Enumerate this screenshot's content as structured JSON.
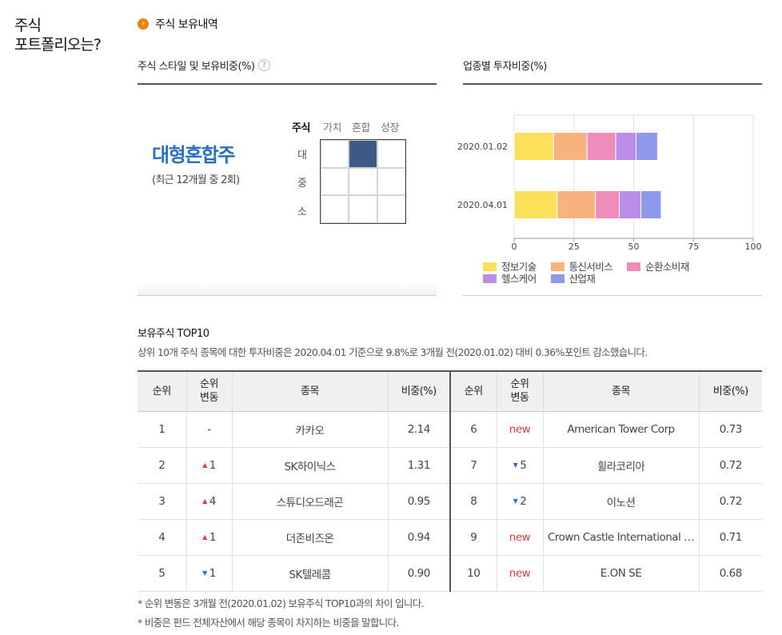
{
  "left_title": [
    "주식",
    "포트폴리오는?"
  ],
  "section_title": "주식 보유내역",
  "style_panel": {
    "title": "주식 스타일 및 보유비중(%)",
    "style_name": "대형혼합주",
    "style_note": "(최근 12개월 중 2회)",
    "col_header": "주식",
    "cols": [
      "가치",
      "혼합",
      "성장"
    ],
    "rows": [
      "대",
      "중",
      "소"
    ],
    "selected": {
      "row": 0,
      "col": 1
    }
  },
  "sector_panel": {
    "title": "업종별 투자비중(%)"
  },
  "chart_data": {
    "type": "bar",
    "orientation": "horizontal",
    "stacked": true,
    "categories": [
      "2020.01.02",
      "2020.04.01"
    ],
    "series": [
      {
        "name": "정보기술",
        "color": "#fde05a",
        "values": [
          16.5,
          18.0
        ]
      },
      {
        "name": "통신서비스",
        "color": "#f7b27d",
        "values": [
          14.0,
          16.0
        ]
      },
      {
        "name": "순환소비재",
        "color": "#ee8cbc",
        "values": [
          12.0,
          10.0
        ]
      },
      {
        "name": "헬스케어",
        "color": "#bb8ce8",
        "values": [
          8.5,
          9.0
        ]
      },
      {
        "name": "산업재",
        "color": "#8e99ec",
        "values": [
          9.0,
          8.5
        ]
      }
    ],
    "xlim": [
      0,
      100
    ],
    "xticks": [
      0,
      25,
      50,
      75,
      100
    ],
    "grid": true,
    "legend": "bottom"
  },
  "top10": {
    "title": "보유주식 TOP10",
    "description": "상위 10개 주식 종목에 대한 투자비중은 2020.04.01 기준으로 9.8%로 3개월 전(2020.01.02) 대비 0.36%포인트 감소했습니다.",
    "headers": {
      "rank": "순위",
      "change_l1": "순위",
      "change_l2": "변동",
      "name": "종목",
      "weight": "비중(%)"
    },
    "rows": [
      {
        "rank": "1",
        "dir": "none",
        "change": "-",
        "name": "카카오",
        "weight": "2.14"
      },
      {
        "rank": "2",
        "dir": "up",
        "change": "1",
        "name": "SK하이닉스",
        "weight": "1.31"
      },
      {
        "rank": "3",
        "dir": "up",
        "change": "4",
        "name": "스튜디오드래곤",
        "weight": "0.95"
      },
      {
        "rank": "4",
        "dir": "up",
        "change": "1",
        "name": "더존비즈온",
        "weight": "0.94"
      },
      {
        "rank": "5",
        "dir": "down",
        "change": "1",
        "name": "SK텔레콤",
        "weight": "0.90"
      },
      {
        "rank": "6",
        "dir": "new",
        "change": "new",
        "name": "American Tower Corp",
        "weight": "0.73"
      },
      {
        "rank": "7",
        "dir": "down",
        "change": "5",
        "name": "휠라코리아",
        "weight": "0.72"
      },
      {
        "rank": "8",
        "dir": "down",
        "change": "2",
        "name": "이노션",
        "weight": "0.72"
      },
      {
        "rank": "9",
        "dir": "new",
        "change": "new",
        "name": "Crown Castle International …",
        "weight": "0.71"
      },
      {
        "rank": "10",
        "dir": "new",
        "change": "new",
        "name": "E.ON SE",
        "weight": "0.68"
      }
    ]
  },
  "footnotes": [
    "* 순위 변동은 3개월 전(2020.01.02) 보유주식 TOP10과의 차이 입니다.",
    "* 비중은 펀드 전체자산에서 해당 종목이 차지하는 비중을 말합니다."
  ]
}
